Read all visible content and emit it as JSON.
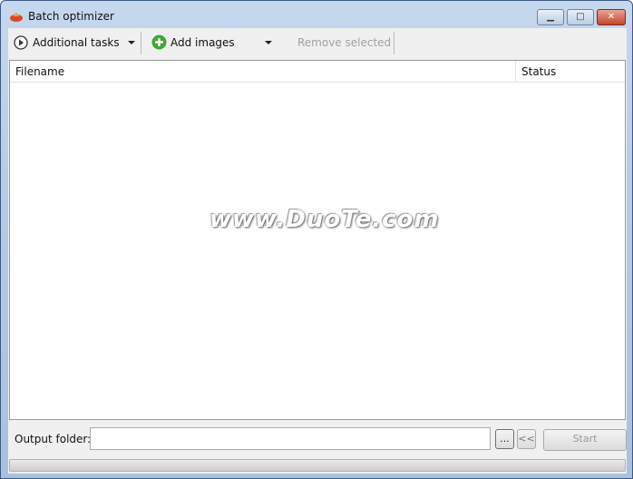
{
  "window": {
    "title": "Batch optimizer",
    "minimize": "▁",
    "maximize": "□",
    "close": "✕"
  },
  "toolbar": {
    "additional_tasks": "Additional tasks",
    "add_images": "Add images",
    "remove_selected": "Remove selected"
  },
  "list": {
    "columns": [
      "Filename",
      "Status"
    ],
    "rows": []
  },
  "watermark": "www.DuoTe.com",
  "bottom": {
    "output_label": "Output folder:",
    "output_value": "",
    "browse": "...",
    "collapse": "<<",
    "start": "Start",
    "progress": 0
  }
}
